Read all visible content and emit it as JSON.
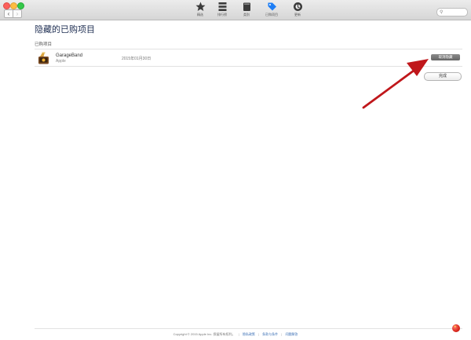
{
  "toolbar": {
    "tabs": [
      {
        "label": "精选",
        "icon": "star-icon"
      },
      {
        "label": "排行榜",
        "icon": "list-icon"
      },
      {
        "label": "类别",
        "icon": "box-icon"
      },
      {
        "label": "已购项目",
        "icon": "tag-icon"
      },
      {
        "label": "更新",
        "icon": "update-icon"
      }
    ],
    "search_icon": "magnifier-icon"
  },
  "page": {
    "title": "隐藏的已购项目",
    "section_label": "已购项目",
    "items": [
      {
        "name": "GarageBand",
        "developer": "Apple",
        "date": "2015年01月30日",
        "action_label": "取消隐藏"
      }
    ],
    "done_label": "完成"
  },
  "footer": {
    "copyright": "Copyright © 2015 Apple Inc. 保留所有权利。",
    "links": [
      "隐私政策",
      "条款与条件",
      "问题解答"
    ]
  },
  "colors": {
    "title": "#1f2f53",
    "annotation_arrow": "#c0171b",
    "selected_tab": "#1e7ef5"
  }
}
